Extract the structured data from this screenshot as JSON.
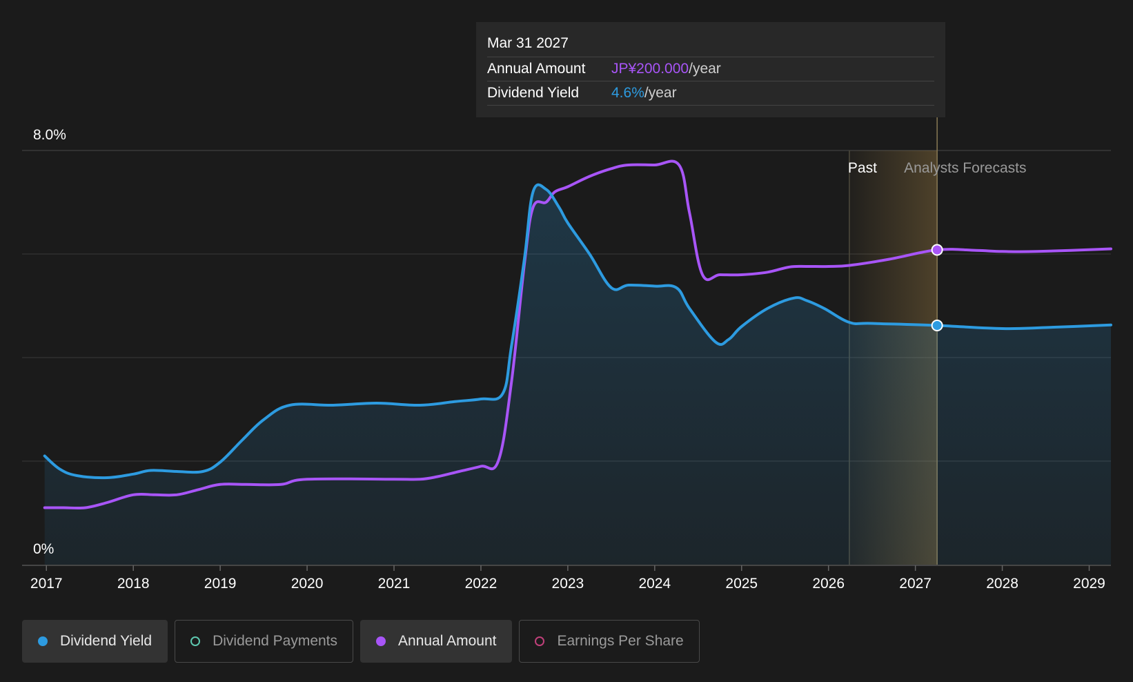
{
  "colors": {
    "background": "#1b1b1b",
    "yield": "#2d9be0",
    "annual": "#a855f7",
    "payments": "#5ec8b0",
    "eps": "#c0407a",
    "forecast_band": "#b9924a",
    "grid": "#3a3a3a"
  },
  "tooltip": {
    "date": "Mar 31 2027",
    "annual_label": "Annual Amount",
    "annual_value": "JP¥200.000",
    "annual_unit": "/year",
    "yield_label": "Dividend Yield",
    "yield_value": "4.6%",
    "yield_unit": "/year"
  },
  "legend": [
    {
      "label": "Dividend Yield",
      "state": "active",
      "marker": "filled-dot",
      "color": "#2d9be0"
    },
    {
      "label": "Dividend Payments",
      "state": "inactive",
      "marker": "hollow-dot",
      "color": "#5ec8b0"
    },
    {
      "label": "Annual Amount",
      "state": "active",
      "marker": "filled-dot",
      "color": "#a855f7"
    },
    {
      "label": "Earnings Per Share",
      "state": "inactive",
      "marker": "hollow-dot",
      "color": "#c0407a"
    }
  ],
  "chart_data": {
    "type": "line",
    "x_ticks": [
      "2017",
      "2018",
      "2019",
      "2020",
      "2021",
      "2022",
      "2023",
      "2024",
      "2025",
      "2026",
      "2027",
      "2028",
      "2029"
    ],
    "y_tick_labels": [
      "8.0%",
      "0%"
    ],
    "ylim": [
      0,
      8
    ],
    "xlim": [
      2016.72,
      2029.25
    ],
    "grid": true,
    "y_gridlines": [
      2,
      4,
      6,
      8
    ],
    "past_label": "Past",
    "forecast_label": "Analysts Forecasts",
    "past_end": 2026.24,
    "forecast_start": 2026.24,
    "forecast_end": 2027.25,
    "selected_x": 2027.25,
    "series": [
      {
        "name": "Dividend Yield",
        "x": [
          2016.98,
          2017.15,
          2017.35,
          2017.7,
          2018.0,
          2018.2,
          2018.5,
          2018.8,
          2019.0,
          2019.25,
          2019.5,
          2019.8,
          2020.3,
          2020.8,
          2021.3,
          2021.7,
          2022.0,
          2022.25,
          2022.35,
          2022.5,
          2022.6,
          2022.75,
          2022.9,
          2023.0,
          2023.25,
          2023.5,
          2023.7,
          2024.0,
          2024.25,
          2024.4,
          2024.7,
          2024.85,
          2025.0,
          2025.3,
          2025.6,
          2025.75,
          2025.95,
          2026.24,
          2026.5,
          2027.25,
          2028.0,
          2028.5,
          2029.25
        ],
        "values": [
          2.1,
          1.85,
          1.72,
          1.68,
          1.75,
          1.82,
          1.8,
          1.8,
          1.98,
          2.4,
          2.8,
          3.08,
          3.08,
          3.12,
          3.08,
          3.15,
          3.2,
          3.3,
          4.2,
          5.9,
          7.2,
          7.25,
          6.9,
          6.6,
          6.0,
          5.35,
          5.4,
          5.38,
          5.35,
          4.95,
          4.3,
          4.35,
          4.6,
          4.95,
          5.15,
          5.1,
          4.95,
          4.68,
          4.66,
          4.62,
          4.56,
          4.58,
          4.63
        ]
      },
      {
        "name": "Annual Amount",
        "x": [
          2016.98,
          2017.2,
          2017.45,
          2017.7,
          2018.0,
          2018.25,
          2018.5,
          2018.75,
          2019.0,
          2019.3,
          2019.7,
          2020.0,
          2021.0,
          2021.3,
          2021.5,
          2021.75,
          2022.0,
          2022.2,
          2022.35,
          2022.5,
          2022.6,
          2022.75,
          2022.85,
          2023.0,
          2023.25,
          2023.5,
          2023.7,
          2024.0,
          2024.28,
          2024.4,
          2024.55,
          2024.75,
          2025.0,
          2025.3,
          2025.55,
          2025.75,
          2026.0,
          2026.24,
          2026.7,
          2027.25,
          2027.7,
          2028.0,
          2028.4,
          2029.25
        ],
        "values": [
          1.1,
          1.1,
          1.1,
          1.2,
          1.35,
          1.35,
          1.35,
          1.45,
          1.55,
          1.55,
          1.55,
          1.65,
          1.65,
          1.65,
          1.7,
          1.8,
          1.9,
          2.0,
          3.5,
          5.8,
          6.9,
          7.0,
          7.2,
          7.3,
          7.5,
          7.65,
          7.72,
          7.72,
          7.72,
          6.8,
          5.6,
          5.6,
          5.6,
          5.65,
          5.75,
          5.76,
          5.76,
          5.78,
          5.9,
          6.08,
          6.07,
          6.05,
          6.05,
          6.1
        ]
      }
    ]
  }
}
